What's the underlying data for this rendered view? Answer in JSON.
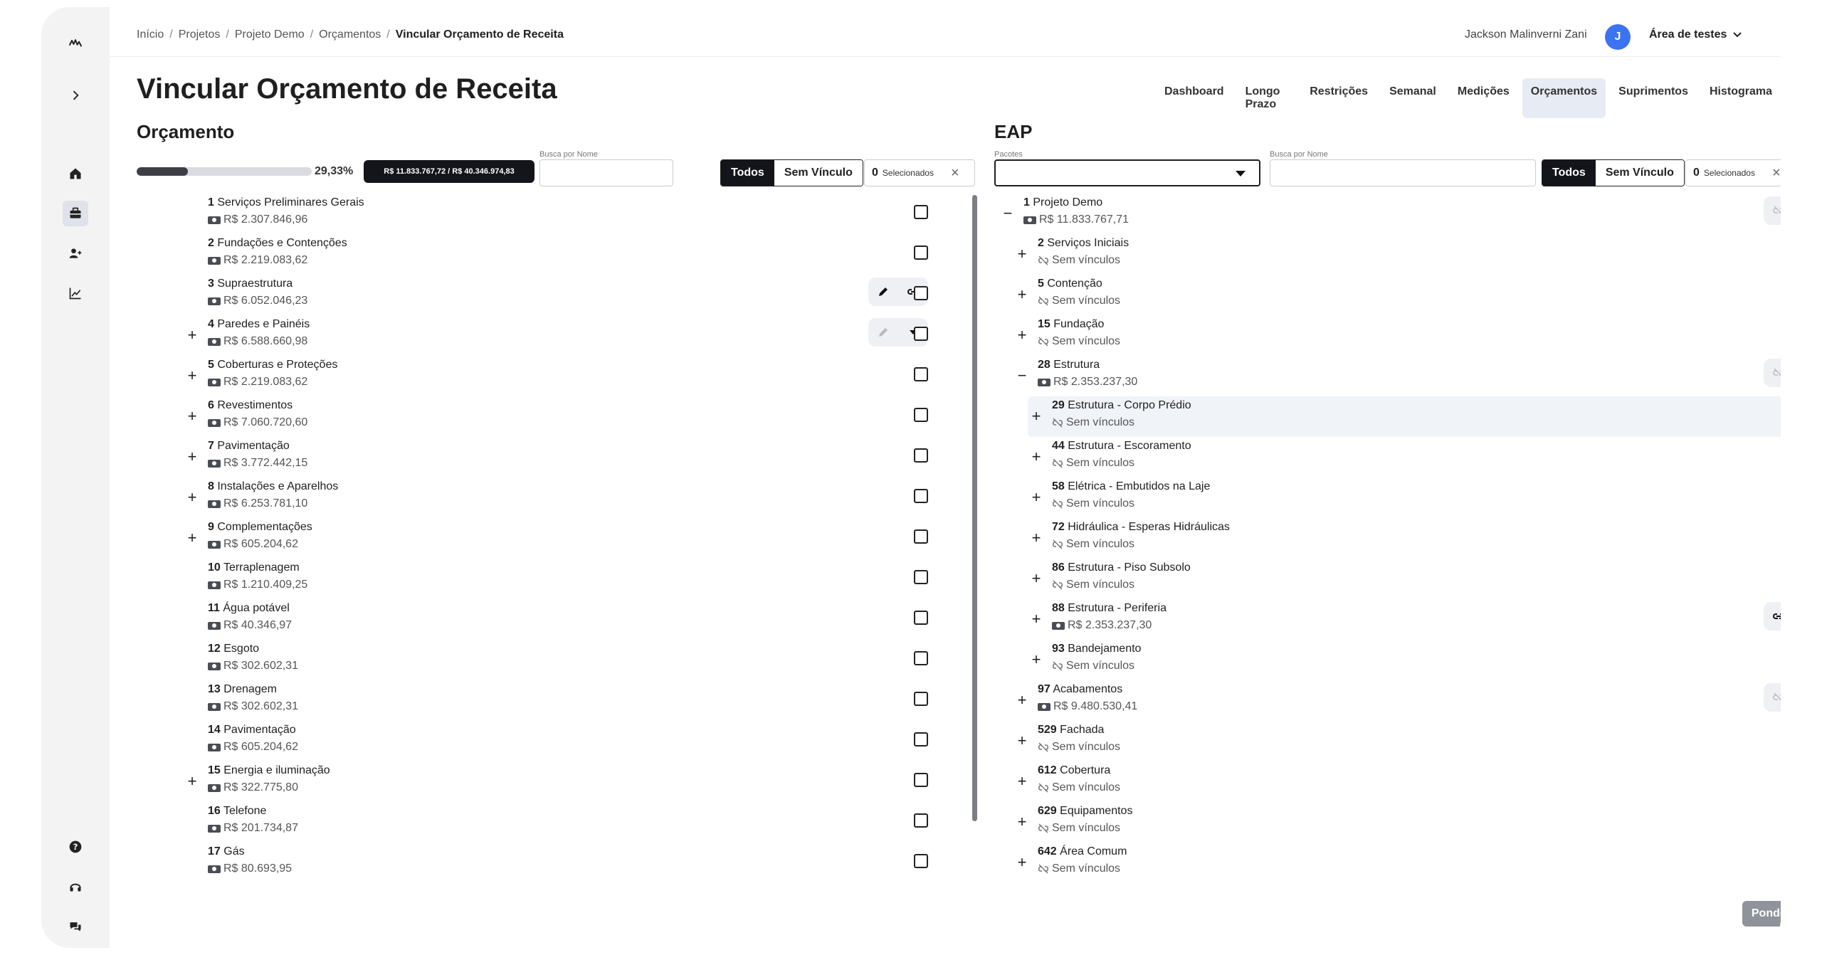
{
  "breadcrumb": [
    "Início",
    "Projetos",
    "Projeto Demo",
    "Orçamentos",
    "Vincular Orçamento de Receita"
  ],
  "user": {
    "name": "Jackson Malinverni Zani",
    "initial": "J",
    "workspace": "Área de testes"
  },
  "title": "Vincular Orçamento de Receita",
  "tabs": [
    "Dashboard",
    "Longo Prazo",
    "Restrições",
    "Semanal",
    "Medições",
    "Orçamentos",
    "Suprimentos",
    "Histograma"
  ],
  "active_tab": "Orçamentos",
  "orcamento": {
    "title": "Orçamento",
    "progress_percent": 29.33,
    "progress_label": "29,33%",
    "totals_label": "R$ 11.833.767,72 / R$ 40.346.974,83",
    "search_label": "Busca por Nome",
    "filter_all": "Todos",
    "filter_unlinked": "Sem Vínculo",
    "selected_count": "0",
    "selected_label": "Selecionados",
    "items": [
      {
        "num": "1",
        "name": "Serviços Preliminares Gerais",
        "value": "R$ 2.307.846,96",
        "expand": ""
      },
      {
        "num": "2",
        "name": "Fundações e Contenções",
        "value": "R$ 2.219.083,62",
        "expand": ""
      },
      {
        "num": "3",
        "name": "Supraestrutura",
        "value": "R$ 6.052.046,23",
        "expand": ""
      },
      {
        "num": "4",
        "name": "Paredes e Painéis",
        "value": "R$ 6.588.660,98",
        "expand": "+"
      },
      {
        "num": "5",
        "name": "Coberturas e Proteções",
        "value": "R$ 2.219.083,62",
        "expand": "+"
      },
      {
        "num": "6",
        "name": "Revestimentos",
        "value": "R$ 7.060.720,60",
        "expand": "+"
      },
      {
        "num": "7",
        "name": "Pavimentação",
        "value": "R$ 3.772.442,15",
        "expand": "+"
      },
      {
        "num": "8",
        "name": "Instalações e Aparelhos",
        "value": "R$ 6.253.781,10",
        "expand": "+"
      },
      {
        "num": "9",
        "name": "Complementações",
        "value": "R$ 605.204,62",
        "expand": "+"
      },
      {
        "num": "10",
        "name": "Terraplenagem",
        "value": "R$ 1.210.409,25",
        "expand": ""
      },
      {
        "num": "11",
        "name": "Água potável",
        "value": "R$ 40.346,97",
        "expand": ""
      },
      {
        "num": "12",
        "name": "Esgoto",
        "value": "R$ 302.602,31",
        "expand": ""
      },
      {
        "num": "13",
        "name": "Drenagem",
        "value": "R$ 302.602,31",
        "expand": ""
      },
      {
        "num": "14",
        "name": "Pavimentação",
        "value": "R$ 605.204,62",
        "expand": ""
      },
      {
        "num": "15",
        "name": "Energia e iluminação",
        "value": "R$ 322.775,80",
        "expand": "+"
      },
      {
        "num": "16",
        "name": "Telefone",
        "value": "R$ 201.734,87",
        "expand": ""
      },
      {
        "num": "17",
        "name": "Gás",
        "value": "R$ 80.693,95",
        "expand": ""
      }
    ]
  },
  "eap": {
    "title": "EAP",
    "packages_label": "Pacotes",
    "search_label": "Busca por Nome",
    "filter_all": "Todos",
    "filter_unlinked": "Sem Vínculo",
    "selected_count": "0",
    "selected_label": "Selecionados",
    "items": [
      {
        "num": "1",
        "name": "Projeto Demo",
        "value": "R$ 11.833.767,71",
        "linked": true,
        "expand": "−",
        "level": 0
      },
      {
        "num": "2",
        "name": "Serviços Iniciais",
        "value": "Sem vínculos",
        "linked": false,
        "expand": "+",
        "level": 1
      },
      {
        "num": "5",
        "name": "Contenção",
        "value": "Sem vínculos",
        "linked": false,
        "expand": "+",
        "level": 1
      },
      {
        "num": "15",
        "name": "Fundação",
        "value": "Sem vínculos",
        "linked": false,
        "expand": "+",
        "level": 1
      },
      {
        "num": "28",
        "name": "Estrutura",
        "value": "R$ 2.353.237,30",
        "linked": true,
        "expand": "−",
        "level": 1
      },
      {
        "num": "29",
        "name": "Estrutura - Corpo Prédio",
        "value": "Sem vínculos",
        "linked": false,
        "expand": "+",
        "level": 2
      },
      {
        "num": "44",
        "name": "Estrutura - Escoramento",
        "value": "Sem vínculos",
        "linked": false,
        "expand": "+",
        "level": 2
      },
      {
        "num": "58",
        "name": "Elétrica - Embutidos na Laje",
        "value": "Sem vínculos",
        "linked": false,
        "expand": "+",
        "level": 2
      },
      {
        "num": "72",
        "name": "Hidráulica - Esperas Hidráulicas",
        "value": "Sem vínculos",
        "linked": false,
        "expand": "+",
        "level": 2
      },
      {
        "num": "86",
        "name": "Estrutura - Piso Subsolo",
        "value": "Sem vínculos",
        "linked": false,
        "expand": "+",
        "level": 2
      },
      {
        "num": "88",
        "name": "Estrutura - Periferia",
        "value": "R$ 2.353.237,30",
        "linked": true,
        "expand": "+",
        "level": 2
      },
      {
        "num": "93",
        "name": "Bandejamento",
        "value": "Sem vínculos",
        "linked": false,
        "expand": "+",
        "level": 2
      },
      {
        "num": "97",
        "name": "Acabamentos",
        "value": "R$ 9.480.530,41",
        "linked": true,
        "expand": "+",
        "level": 1
      },
      {
        "num": "529",
        "name": "Fachada",
        "value": "Sem vínculos",
        "linked": false,
        "expand": "+",
        "level": 1
      },
      {
        "num": "612",
        "name": "Cobertura",
        "value": "Sem vínculos",
        "linked": false,
        "expand": "+",
        "level": 1
      },
      {
        "num": "629",
        "name": "Equipamentos",
        "value": "Sem vínculos",
        "linked": false,
        "expand": "+",
        "level": 1
      },
      {
        "num": "642",
        "name": "Área Comum",
        "value": "Sem vínculos",
        "linked": false,
        "expand": "+",
        "level": 1
      }
    ]
  },
  "ponderar_label": "Ponderar",
  "colors": {
    "accent": "#3b73f0",
    "dark": "#14151a",
    "highlight": "#f0f3f8"
  }
}
